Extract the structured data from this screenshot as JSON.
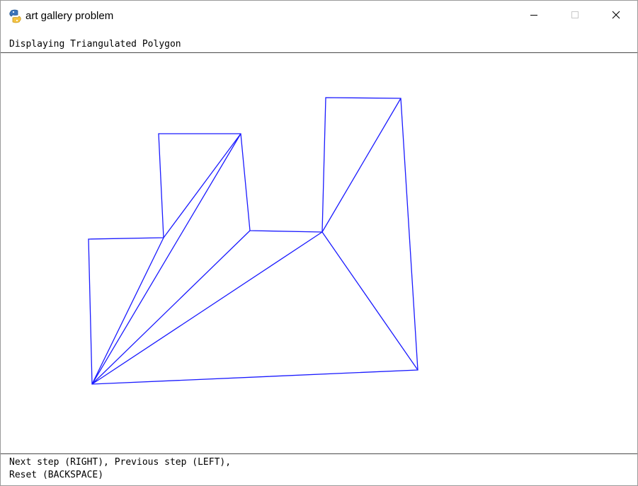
{
  "window": {
    "title": "art gallery problem",
    "icon": "python-snake-icon",
    "controls": {
      "minimize": "minimize-icon",
      "maximize": "maximize-icon",
      "close": "close-icon"
    }
  },
  "status": {
    "message": "Displaying Triangulated Polygon"
  },
  "help": {
    "line1": "Next step (RIGHT), Previous step (LEFT),",
    "line2": "Reset (BACKSPACE)"
  },
  "colors": {
    "edge": "#1a1aff",
    "background": "#ffffff"
  }
}
